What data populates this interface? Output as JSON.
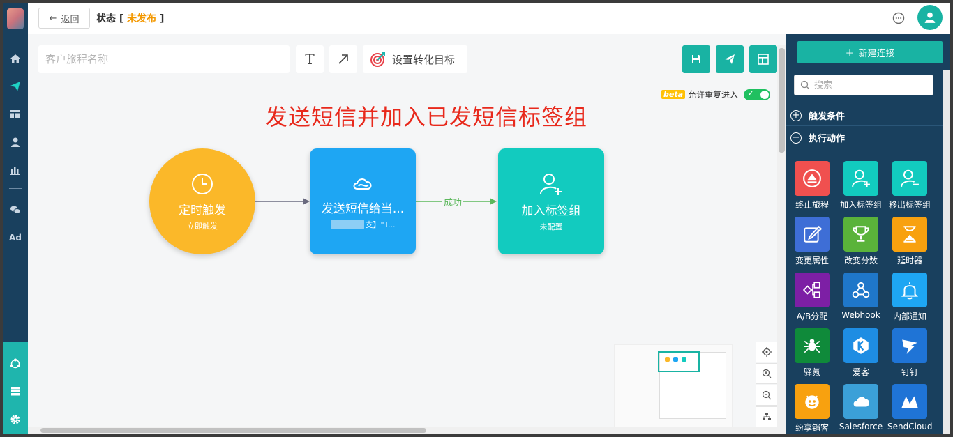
{
  "topbar": {
    "back_label": "返回",
    "status_label": "状态",
    "status_value": "未发布"
  },
  "toolbar": {
    "name_placeholder": "客户旅程名称",
    "text_tool_glyph": "T",
    "goal_label": "设置转化目标",
    "beta_badge": "beta",
    "reentry_label": "允许重复进入"
  },
  "canvas": {
    "annotation": "发送短信并加入已发短信标签组",
    "nodes": {
      "trigger": {
        "title": "定时触发",
        "sub": "立即触发"
      },
      "sms": {
        "title": "发送短信给当...",
        "sub_suffix": "支】\"T..."
      },
      "tag": {
        "title": "加入标签组",
        "sub": "未配置"
      }
    },
    "edge_label": "成功"
  },
  "panel": {
    "new_connection": "新建连接",
    "search_placeholder": "搜索",
    "section_trigger": "触发条件",
    "section_actions": "执行动作",
    "tiles": [
      {
        "label": "终止旅程",
        "color": "#f0504f",
        "icon": "eject-icon"
      },
      {
        "label": "加入标签组",
        "color": "#12cbbf",
        "icon": "user-add-icon"
      },
      {
        "label": "移出标签组",
        "color": "#12cbbf",
        "icon": "user-remove-icon"
      },
      {
        "label": "变更属性",
        "color": "#3e6ed6",
        "icon": "edit-icon"
      },
      {
        "label": "改变分数",
        "color": "#5ab33a",
        "icon": "trophy-icon"
      },
      {
        "label": "延时器",
        "color": "#f8a10f",
        "icon": "hourglass-icon"
      },
      {
        "label": "A/B分配",
        "color": "#7d1fa5",
        "icon": "ab-split-icon"
      },
      {
        "label": "Webhook",
        "color": "#1f77c9",
        "icon": "webhook-icon"
      },
      {
        "label": "内部通知",
        "color": "#1ea6f3",
        "icon": "bell-icon"
      },
      {
        "label": "驿氪",
        "color": "#0f8a3a",
        "icon": "spider-icon"
      },
      {
        "label": "爱客",
        "color": "#1e8de3",
        "icon": "k-logo-icon"
      },
      {
        "label": "钉钉",
        "color": "#1f74d6",
        "icon": "dingtalk-icon"
      },
      {
        "label": "纷享销客",
        "color": "#f8a10f",
        "icon": "fxiaoke-icon"
      },
      {
        "label": "Salesforce",
        "color": "#3ba0d8",
        "icon": "cloud-icon"
      },
      {
        "label": "SendCloud",
        "color": "#1f74d6",
        "icon": "sendcloud-icon"
      }
    ]
  }
}
